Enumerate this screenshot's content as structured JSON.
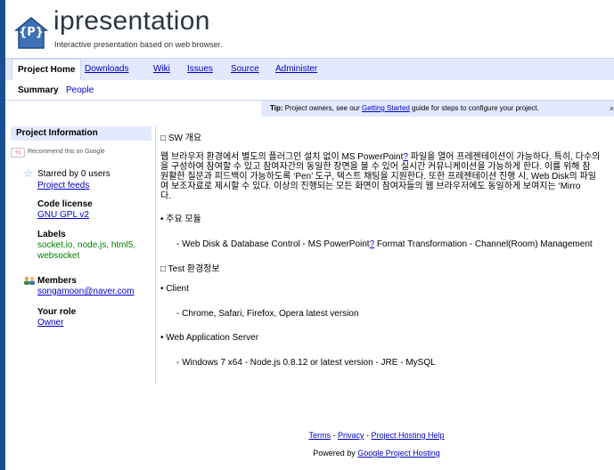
{
  "header": {
    "logo_letter": "{P}",
    "title": "ipresentation",
    "subtitle": "Interactive presentation based on web browser."
  },
  "tabs": [
    {
      "label": "Project Home",
      "active": true
    },
    {
      "label": "Downloads",
      "active": false
    },
    {
      "label": "Wiki",
      "active": false
    },
    {
      "label": "Issues",
      "active": false
    },
    {
      "label": "Source",
      "active": false
    },
    {
      "label": "Administer",
      "active": false
    }
  ],
  "subnav": {
    "summary": "Summary",
    "people": "People"
  },
  "tip": {
    "prefix": "Tip:",
    "text1": "Project owners, see our",
    "link": "Getting Started",
    "text2": "guide for steps to configure your project.",
    "close": "×"
  },
  "sidebar": {
    "heading": "Project Information",
    "gplus": "+1",
    "recommend": "Recommend this on Google",
    "starred": "Starred by 0 users",
    "project_feeds": "Project feeds",
    "code_license_label": "Code license",
    "code_license_value": "GNU GPL v2",
    "labels_label": "Labels",
    "labels_line1": "socket.io, node.js, html5,",
    "labels_line2": "websocket",
    "members_label": "Members",
    "members_value": "songamoon@naver.com",
    "role_label": "Your role",
    "role_value": "Owner"
  },
  "content": {
    "sw_heading": "□ SW 개요",
    "p1_l1": "웹 브라우저 환경에서 별도의 플러그인 설치 없이 MS PowerPoint",
    "p1_l1_q": "?",
    "p1_l1_rest": " 파일을 열어 프레젠테이션이 가능하다. 특히, 다수의",
    "p1_l2": "을 구성하여 참여할 수 있고 참여자간의 동일한 장면을 볼 수 있어 실시간 커뮤니케이션을 가능하게 한다. 이를 위해 참",
    "p1_l3": "원활한 질문과 피드백이 가능하도록 ‘Pen’ 도구, 텍스트 채팅을 지원한다. 또한 프레젠테이션 진행 시, Web Disk의 파일",
    "p1_l4": "여 보조자료로 제시할 수 있다. 이상의 진행되는 모든 화면이 참여자들의 웹 브라우저에도 동일하게 보여지는 ‘Mirro",
    "p1_l5": "다.",
    "modules_heading": "• 주요 모듈",
    "modules_l1": "- Web Disk & Database Control - MS PowerPoint",
    "modules_q": "?",
    "modules_l1_rest": " Format Transformation - Channel(Room) Management",
    "test_heading": "□ Test 환경정보",
    "client_heading": "• Client",
    "client_line": "- Chrome, Safari, Firefox, Opera latest version",
    "server_heading": "• Web Application Server",
    "server_line": "- Windows 7 x64 - Node.js 0.8.12 or latest version - JRE - MySQL"
  },
  "footer": {
    "terms": "Terms",
    "privacy": "Privacy",
    "help": "Project Hosting Help",
    "sep": " - ",
    "powered_prefix": "Powered by",
    "powered_link": "Google Project Hosting"
  },
  "colors": {
    "link": "#0000cc",
    "tab_bar": "#e3e9ff",
    "labels_green": "#008000",
    "desktop": "#1b4f93"
  }
}
